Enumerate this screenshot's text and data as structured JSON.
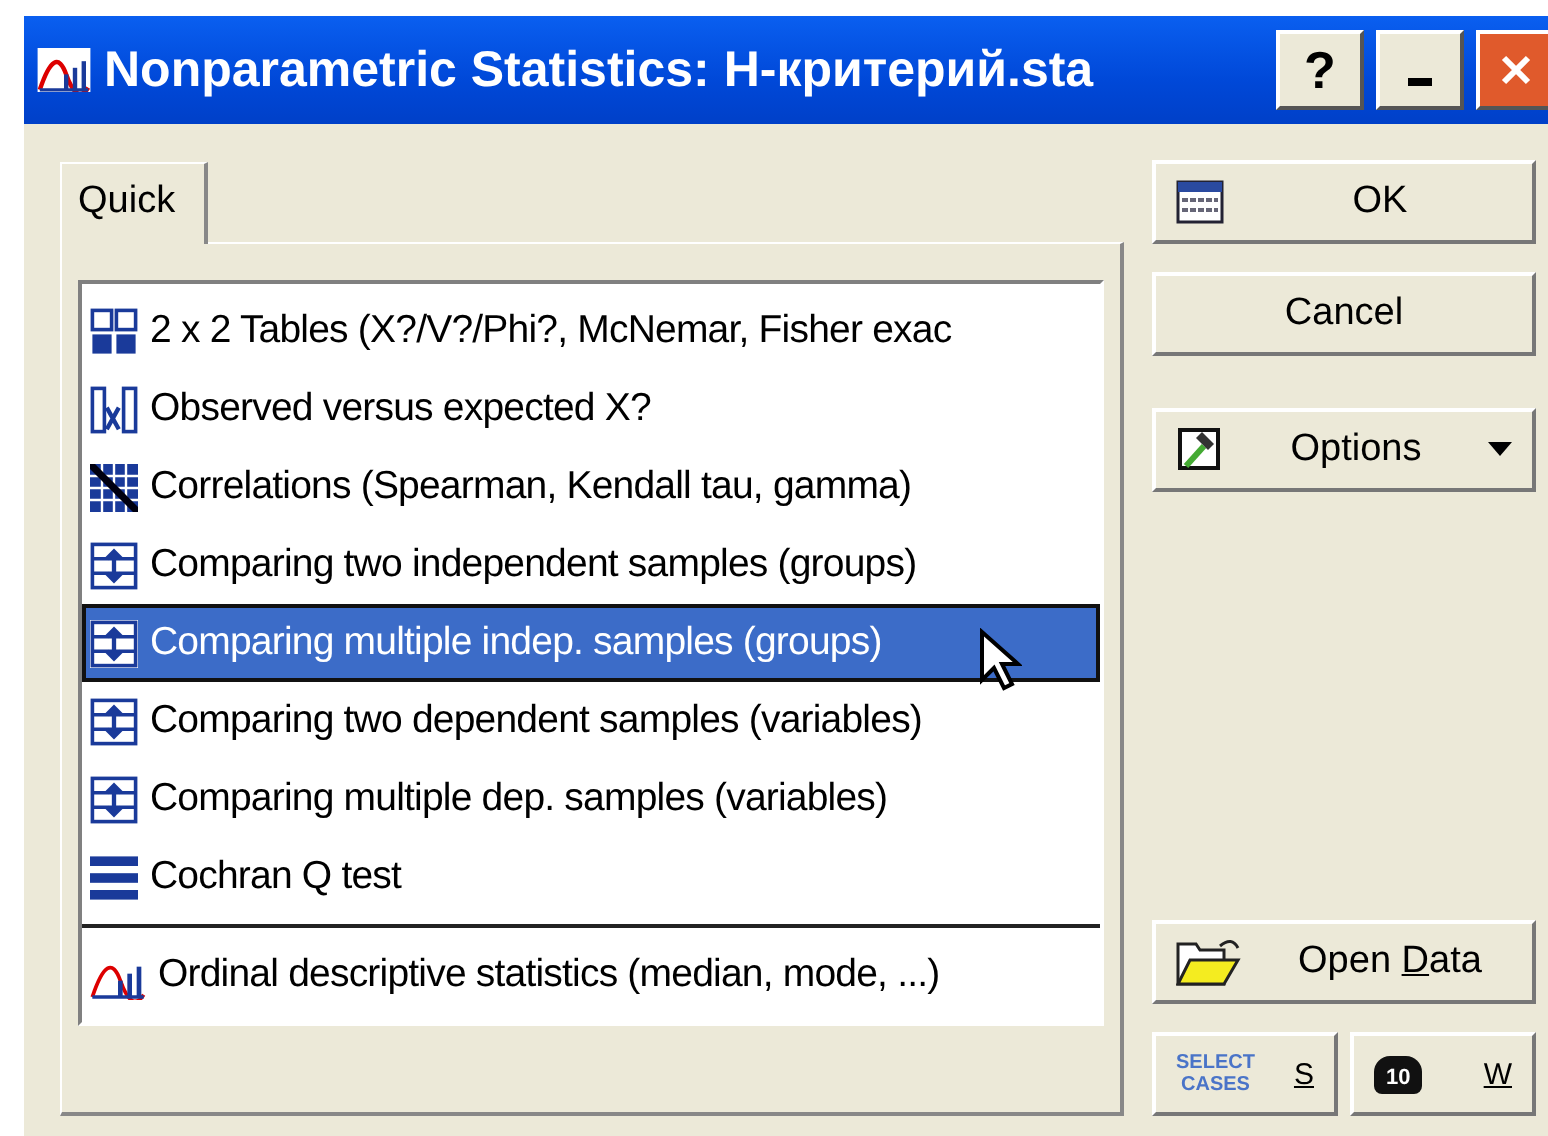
{
  "window": {
    "title": "Nonparametric Statistics: H-критерий.sta",
    "buttons": [
      "?"
    ]
  },
  "tabs": [
    {
      "label": "Quick",
      "selected": true
    }
  ],
  "methods": [
    {
      "label": "2 x 2 Tables (X?/V?/Phi?, McNemar, Fisher exac",
      "selected": false
    },
    {
      "label": "Observed versus expected X?",
      "selected": false
    },
    {
      "label": "Correlations (Spearman, Kendall tau, gamma)",
      "selected": false
    },
    {
      "label": "Comparing two independent samples (groups)",
      "selected": false
    },
    {
      "label": "Comparing multiple indep. samples (groups)",
      "selected": true
    },
    {
      "label": "Comparing two dependent samples (variables)",
      "selected": false
    },
    {
      "label": "Comparing multiple dep. samples (variables)",
      "selected": false
    },
    {
      "label": "Cochran Q test",
      "selected": false
    }
  ],
  "extra_methods": [
    {
      "label": "Ordinal descriptive statistics (median, mode, ...)",
      "selected": false
    }
  ],
  "side_buttons": {
    "ok": "OK",
    "cancel": "Cancel",
    "options": "Options",
    "open_data": {
      "label": "Open ",
      "accelerator": "D",
      "label_rest": "ata"
    },
    "select_cases": {
      "icon_text": [
        "SELECT",
        "CASES"
      ],
      "label": "S"
    },
    "weights": {
      "icon_text": "10",
      "label": "W"
    }
  }
}
